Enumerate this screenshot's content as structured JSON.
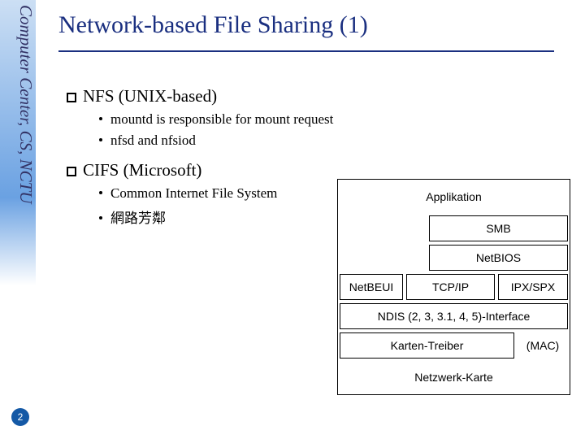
{
  "sidebar": {
    "org": "Computer Center, CS, NCTU",
    "page": "2"
  },
  "title": "Network-based File Sharing (1)",
  "bullets": {
    "nfs": {
      "label": "NFS (UNIX-based)",
      "sub1": "mountd is responsible for mount request",
      "sub2": "nfsd and nfsiod"
    },
    "cifs": {
      "label": "CIFS (Microsoft)",
      "sub1": "Common Internet File System",
      "sub2": "網路芳鄰"
    }
  },
  "diagram": {
    "row1": "Applikation",
    "row2": "SMB",
    "row3": "NetBIOS",
    "row4a": "NetBEUI",
    "row4b": "TCP/IP",
    "row4c": "IPX/SPX",
    "row5": "NDIS (2, 3, 3.1, 4, 5)-Interface",
    "row6a": "Karten-Treiber",
    "row6b": "(MAC)",
    "row7": "Netzwerk-Karte"
  }
}
